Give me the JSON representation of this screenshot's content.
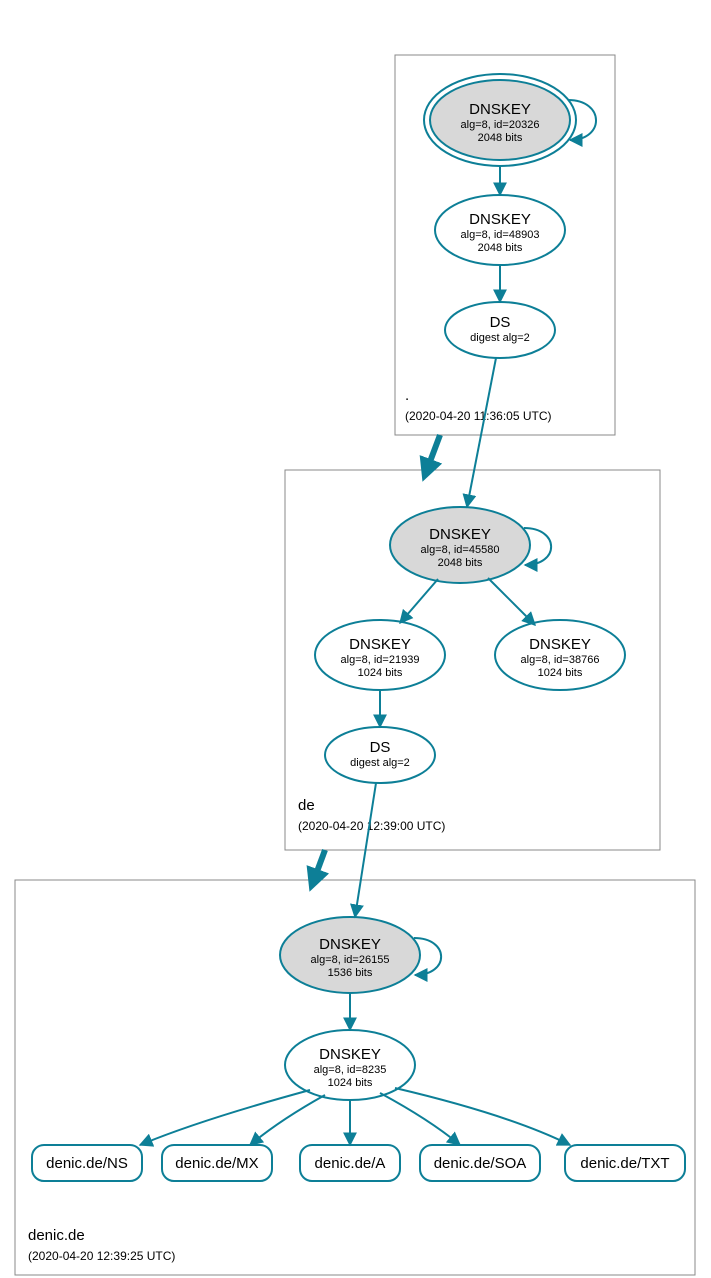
{
  "colors": {
    "stroke": "#0d7f97",
    "ksk_fill": "#d8d8d8"
  },
  "zones": {
    "root": {
      "label": ".",
      "date": "(2020-04-20 11:36:05 UTC)"
    },
    "de": {
      "label": "de",
      "date": "(2020-04-20 12:39:00 UTC)"
    },
    "denic": {
      "label": "denic.de",
      "date": "(2020-04-20 12:39:25 UTC)"
    }
  },
  "nodes": {
    "root_ksk": {
      "title": "DNSKEY",
      "sub1": "alg=8, id=20326",
      "sub2": "2048 bits"
    },
    "root_zsk": {
      "title": "DNSKEY",
      "sub1": "alg=8, id=48903",
      "sub2": "2048 bits"
    },
    "root_ds": {
      "title": "DS",
      "sub1": "digest alg=2"
    },
    "de_ksk": {
      "title": "DNSKEY",
      "sub1": "alg=8, id=45580",
      "sub2": "2048 bits"
    },
    "de_zsk1": {
      "title": "DNSKEY",
      "sub1": "alg=8, id=21939",
      "sub2": "1024 bits"
    },
    "de_zsk2": {
      "title": "DNSKEY",
      "sub1": "alg=8, id=38766",
      "sub2": "1024 bits"
    },
    "de_ds": {
      "title": "DS",
      "sub1": "digest alg=2"
    },
    "denic_ksk": {
      "title": "DNSKEY",
      "sub1": "alg=8, id=26155",
      "sub2": "1536 bits"
    },
    "denic_zsk": {
      "title": "DNSKEY",
      "sub1": "alg=8, id=8235",
      "sub2": "1024 bits"
    },
    "rr_ns": {
      "title": "denic.de/NS"
    },
    "rr_mx": {
      "title": "denic.de/MX"
    },
    "rr_a": {
      "title": "denic.de/A"
    },
    "rr_soa": {
      "title": "denic.de/SOA"
    },
    "rr_txt": {
      "title": "denic.de/TXT"
    }
  }
}
